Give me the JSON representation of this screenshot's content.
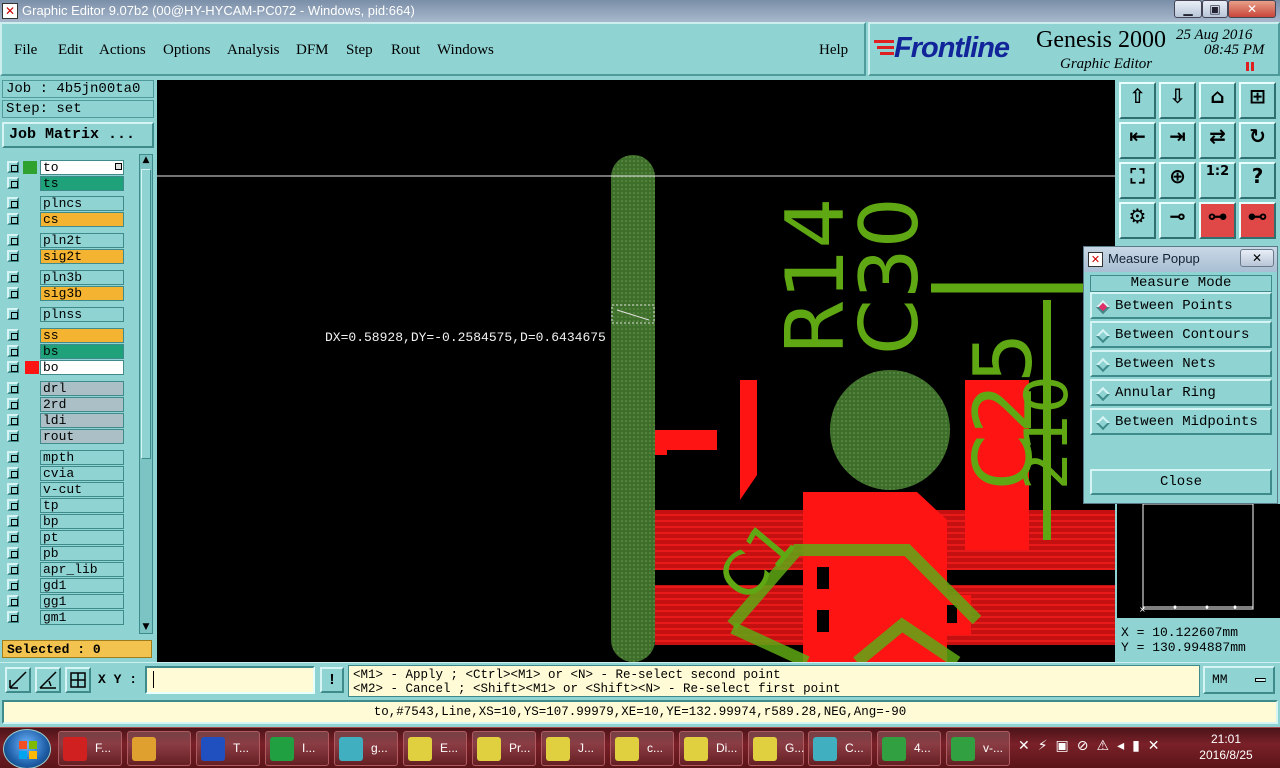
{
  "window": {
    "title": "Graphic Editor 9.07b2 (00@HY-HYCAM-PC072 - Windows, pid:664)"
  },
  "menu": {
    "items": [
      "File",
      "Edit",
      "Actions",
      "Options",
      "Analysis",
      "DFM",
      "Step",
      "Rout",
      "Windows"
    ],
    "help": "Help"
  },
  "brand": {
    "logo": "Frontline",
    "product": "Genesis 2000",
    "subtitle": "Graphic Editor",
    "date": "25 Aug 2016",
    "time": "08:45 PM"
  },
  "job": {
    "job_label": "Job : 4b5jn00ta0",
    "step_label": "Step: set",
    "matrix_button": "Job Matrix ..."
  },
  "layers": [
    {
      "name": "to",
      "color": "#ffffff",
      "swatch": "#2fa12f",
      "active": true
    },
    {
      "name": "ts",
      "color": "#1fa27a",
      "swatch": ""
    },
    {
      "name": "plncs",
      "color": "#8fd3d3",
      "swatch": ""
    },
    {
      "name": "cs",
      "color": "#f4b431",
      "swatch": ""
    },
    {
      "name": "pln2t",
      "color": "#8fd3d3",
      "swatch": ""
    },
    {
      "name": "sig2t",
      "color": "#f4b431",
      "swatch": ""
    },
    {
      "name": "pln3b",
      "color": "#8fd3d3",
      "swatch": ""
    },
    {
      "name": "sig3b",
      "color": "#f4b431",
      "swatch": ""
    },
    {
      "name": "plnss",
      "color": "#8fd3d3",
      "swatch": ""
    },
    {
      "name": "ss",
      "color": "#f4b431",
      "swatch": ""
    },
    {
      "name": "bs",
      "color": "#1fa27a",
      "swatch": ""
    },
    {
      "name": "bo",
      "color": "#ffffff",
      "swatch": "#ff1414"
    },
    {
      "name": "drl",
      "color": "#aabfc6",
      "swatch": ""
    },
    {
      "name": "2rd",
      "color": "#aabfc6",
      "swatch": ""
    },
    {
      "name": "ldi",
      "color": "#aabfc6",
      "swatch": ""
    },
    {
      "name": "rout",
      "color": "#aabfc6",
      "swatch": ""
    },
    {
      "name": "mpth",
      "color": "#8fd3d3",
      "swatch": ""
    },
    {
      "name": "cvia",
      "color": "#8fd3d3",
      "swatch": ""
    },
    {
      "name": "v-cut",
      "color": "#8fd3d3",
      "swatch": ""
    },
    {
      "name": "tp",
      "color": "#8fd3d3",
      "swatch": ""
    },
    {
      "name": "bp",
      "color": "#8fd3d3",
      "swatch": ""
    },
    {
      "name": "pt",
      "color": "#8fd3d3",
      "swatch": ""
    },
    {
      "name": "pb",
      "color": "#8fd3d3",
      "swatch": ""
    },
    {
      "name": "apr_lib",
      "color": "#8fd3d3",
      "swatch": ""
    },
    {
      "name": "gd1",
      "color": "#8fd3d3",
      "swatch": ""
    },
    {
      "name": "gg1",
      "color": "#8fd3d3",
      "swatch": ""
    },
    {
      "name": "gm1",
      "color": "#8fd3d3",
      "swatch": ""
    }
  ],
  "selected": "Selected : 0",
  "canvas": {
    "measure_readout": "DX=0.58928,DY=-0.2584575,D=0.6434675",
    "silk_labels": [
      "R14",
      "C30",
      "C25",
      "C1"
    ],
    "colors": {
      "silk": "#5fa814",
      "copper": "#ff1414",
      "background": "#000000"
    }
  },
  "measure_popup": {
    "title": "Measure Popup",
    "mode_label": "Measure Mode",
    "options": [
      "Between Points",
      "Between Contours",
      "Between Nets",
      "Annular Ring",
      "Between Midpoints"
    ],
    "selected_index": 0,
    "close": "Close"
  },
  "coords": {
    "x": "X = 10.122607mm",
    "y": "Y = 130.994887mm"
  },
  "bottom": {
    "xy_label": "X Y :",
    "xy_value": "",
    "hint_line1": "<M1> - Apply  ; <Ctrl><M1> or <N> - Re-select second point",
    "hint_line2": "<M2> - Cancel ; <Shift><M1> or <Shift><N> - Re-select first point",
    "units": "MM"
  },
  "status": "to,#7543,Line,XS=10,YS=107.99979,XE=10,YE=132.99974,r589.28,NEG,Ang=-90",
  "taskbar": {
    "items": [
      "F...",
      "",
      "T...",
      "I...",
      "g...",
      "E...",
      "Pr...",
      "J...",
      "c...",
      "Di...",
      "G...",
      "C...",
      "4...",
      "v-..."
    ],
    "time": "21:01",
    "date": "2016/8/25"
  }
}
